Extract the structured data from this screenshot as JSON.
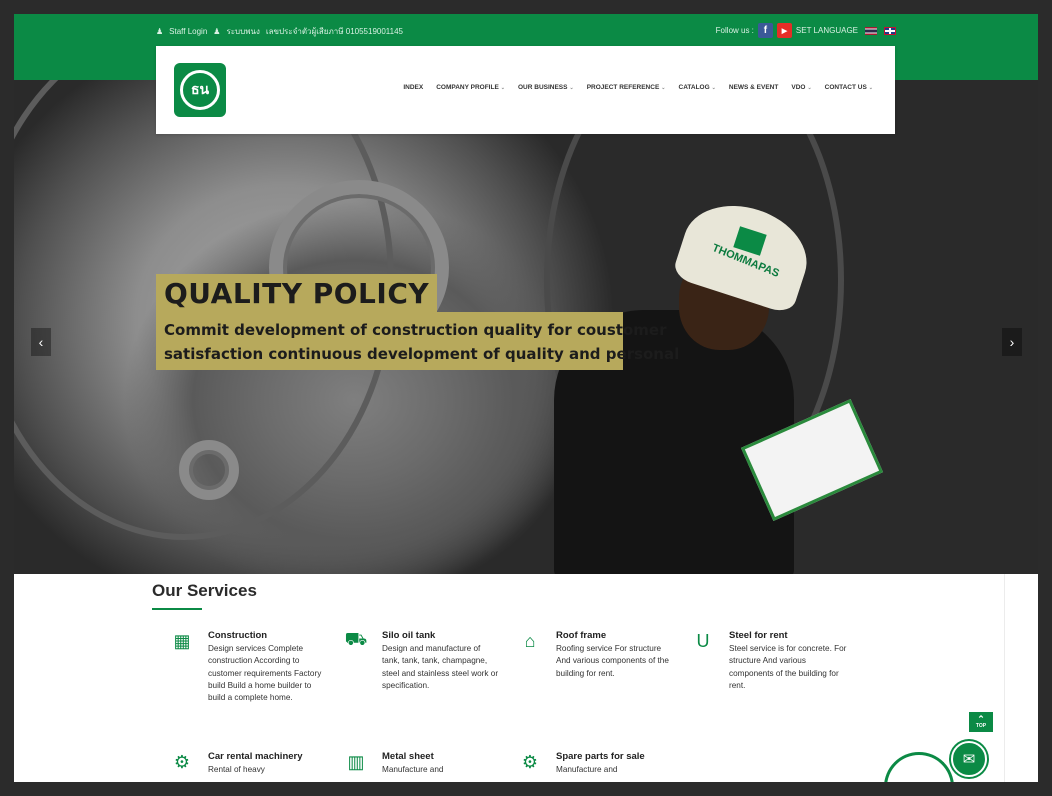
{
  "topbar": {
    "staff_login": "Staff Login",
    "thai_link": "ระบบพนง",
    "tax_id": "เลขประจำตัวผู้เสียภาษี 0105519001145",
    "follow_label": "Follow us :",
    "language_label": "SET LANGUAGE",
    "facebook_glyph": "f",
    "youtube_glyph": "▶"
  },
  "logo": {
    "text": "ธน"
  },
  "nav": [
    {
      "label": "INDEX",
      "dropdown": false
    },
    {
      "label": "COMPANY PROFILE",
      "dropdown": true
    },
    {
      "label": "OUR BUSINESS",
      "dropdown": true
    },
    {
      "label": "PROJECT REFERENCE",
      "dropdown": true
    },
    {
      "label": "CATALOG",
      "dropdown": true
    },
    {
      "label": "NEWS & EVENT",
      "dropdown": false
    },
    {
      "label": "VDO",
      "dropdown": true
    },
    {
      "label": "CONTACT US",
      "dropdown": true
    }
  ],
  "hero": {
    "title": "QUALITY POLICY",
    "line1": "Commit development of construction quality for coustomer",
    "line2": "satisfaction continuous development of quality and personal",
    "helmet_text": "THOMMAPAS",
    "prev_glyph": "‹",
    "next_glyph": "›"
  },
  "services": {
    "title": "Our Services",
    "items": [
      {
        "name": "Construction",
        "icon": "building-icon",
        "glyph": "▦",
        "desc": "Design services Complete construction According to customer requirements Factory build Build a home builder to build a complete home."
      },
      {
        "name": "Silo oil tank",
        "icon": "truck-icon",
        "glyph": "⛟",
        "desc": "Design and manufacture of tank, tank, tank, champagne, steel and stainless steel work or specification."
      },
      {
        "name": "Roof frame",
        "icon": "home-icon",
        "glyph": "⌂",
        "desc": "Roofing service For structure And various components of the building for rent."
      },
      {
        "name": "Steel for rent",
        "icon": "magnet-icon",
        "glyph": "U",
        "desc": "Steel service is for concrete. For structure And various components of the building for rent."
      },
      {
        "name": "Car rental machinery",
        "icon": "cog-icon",
        "glyph": "⚙",
        "desc": "Rental of heavy"
      },
      {
        "name": "Metal sheet",
        "icon": "map-icon",
        "glyph": "▥",
        "desc": "Manufacture and"
      },
      {
        "name": "Spare parts for sale",
        "icon": "cogs-icon",
        "glyph": "⚙",
        "desc": "Manufacture and"
      }
    ]
  },
  "floating": {
    "top_label": "TOP",
    "top_glyph": "⌃",
    "messenger_glyph": "✉"
  },
  "colors": {
    "brand_green": "#0b8a45",
    "caption_bg": "#b7a95c"
  }
}
